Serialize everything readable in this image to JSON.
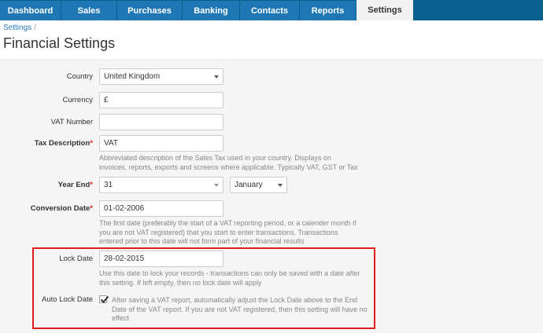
{
  "nav": {
    "tabs": [
      "Dashboard",
      "Sales",
      "Purchases",
      "Banking",
      "Contacts",
      "Reports",
      "Settings"
    ],
    "active": "Settings"
  },
  "breadcrumb": {
    "link": "Settings",
    "separator": "/"
  },
  "page": {
    "title": "Financial Settings"
  },
  "form": {
    "country": {
      "label": "Country",
      "value": "United Kingdom"
    },
    "currency": {
      "label": "Currency",
      "value": "£"
    },
    "vat_number": {
      "label": "VAT Number",
      "value": ""
    },
    "tax_description": {
      "label": "Tax Description",
      "required_mark": "*",
      "value": "VAT",
      "help_lines": [
        "Abbreviated description of the Sales Tax used in your country. Displays on",
        "invoices, reports, exports and screens where applicable. Typically VAT, GST or Tax"
      ]
    },
    "year_end": {
      "label": "Year End",
      "required_mark": "*",
      "day_value": "31",
      "month_value": "January"
    },
    "conversion_date": {
      "label": "Conversion Date",
      "required_mark": "*",
      "value": "01-02-2006",
      "help_lines": [
        "The first date (preferably the start of a VAT reporting period, or a calender month if",
        "you are not VAT registered) that you start to enter transactions. Transactions",
        "entered prior to this date will not form part of your financial results"
      ]
    },
    "lock_date": {
      "label": "Lock Date",
      "value": "28-02-2015",
      "help_lines": [
        "Use this date to lock your records - transactions can only be saved with a date after",
        "this setting. If left empty, then no lock date will apply"
      ]
    },
    "auto_lock_date": {
      "label": "Auto Lock Date",
      "checked": true,
      "help_lines": [
        "After saving a VAT report, automatically adjust the Lock Date above to the End",
        "Date of the VAT report. If you are not VAT registered, then this setting will have no",
        "effect"
      ]
    }
  },
  "colors": {
    "nav_bg": "#0b5f8e",
    "tab_bg": "#1f78b4",
    "active_tab_bg": "#f2f2f2",
    "highlight": "#e01b1b",
    "required": "#d9261c",
    "link": "#2a7ab8"
  }
}
